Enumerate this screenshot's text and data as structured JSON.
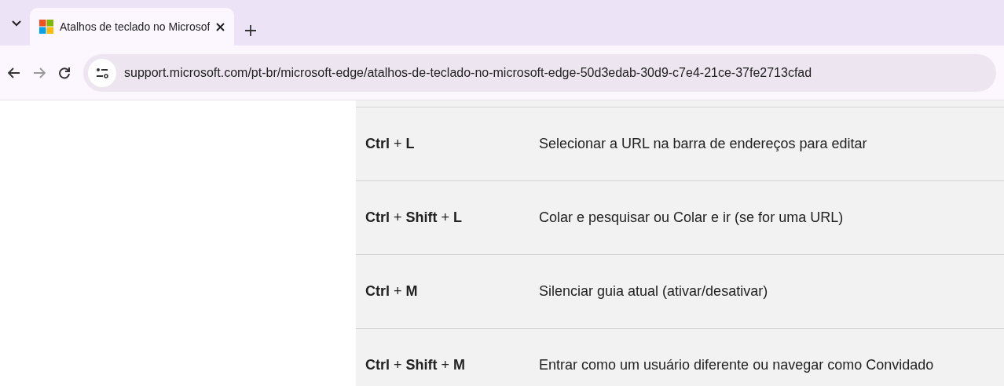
{
  "browser": {
    "tabs": [
      {
        "title": "Atalhos de teclado no Microsof",
        "selected": true
      }
    ],
    "url": "support.microsoft.com/pt-br/microsoft-edge/atalhos-de-teclado-no-microsoft-edge-50d3edab-30d9-c7e4-21ce-37fe2713cfad"
  },
  "shortcuts": [
    {
      "keys": "**Ctrl** + **L**",
      "description": "Selecionar a URL na barra de endereços para editar"
    },
    {
      "keys": "**Ctrl** + **Shift** + **L**",
      "description": "Colar e pesquisar ou Colar e ir (se for uma URL)"
    },
    {
      "keys": "**Ctrl** + **M**",
      "description": "Silenciar guia atual (ativar/desativar)"
    },
    {
      "keys": "**Ctrl** + **Shift** + **M**",
      "description": "Entrar como um usuário diferente ou navegar como Convidado"
    }
  ]
}
